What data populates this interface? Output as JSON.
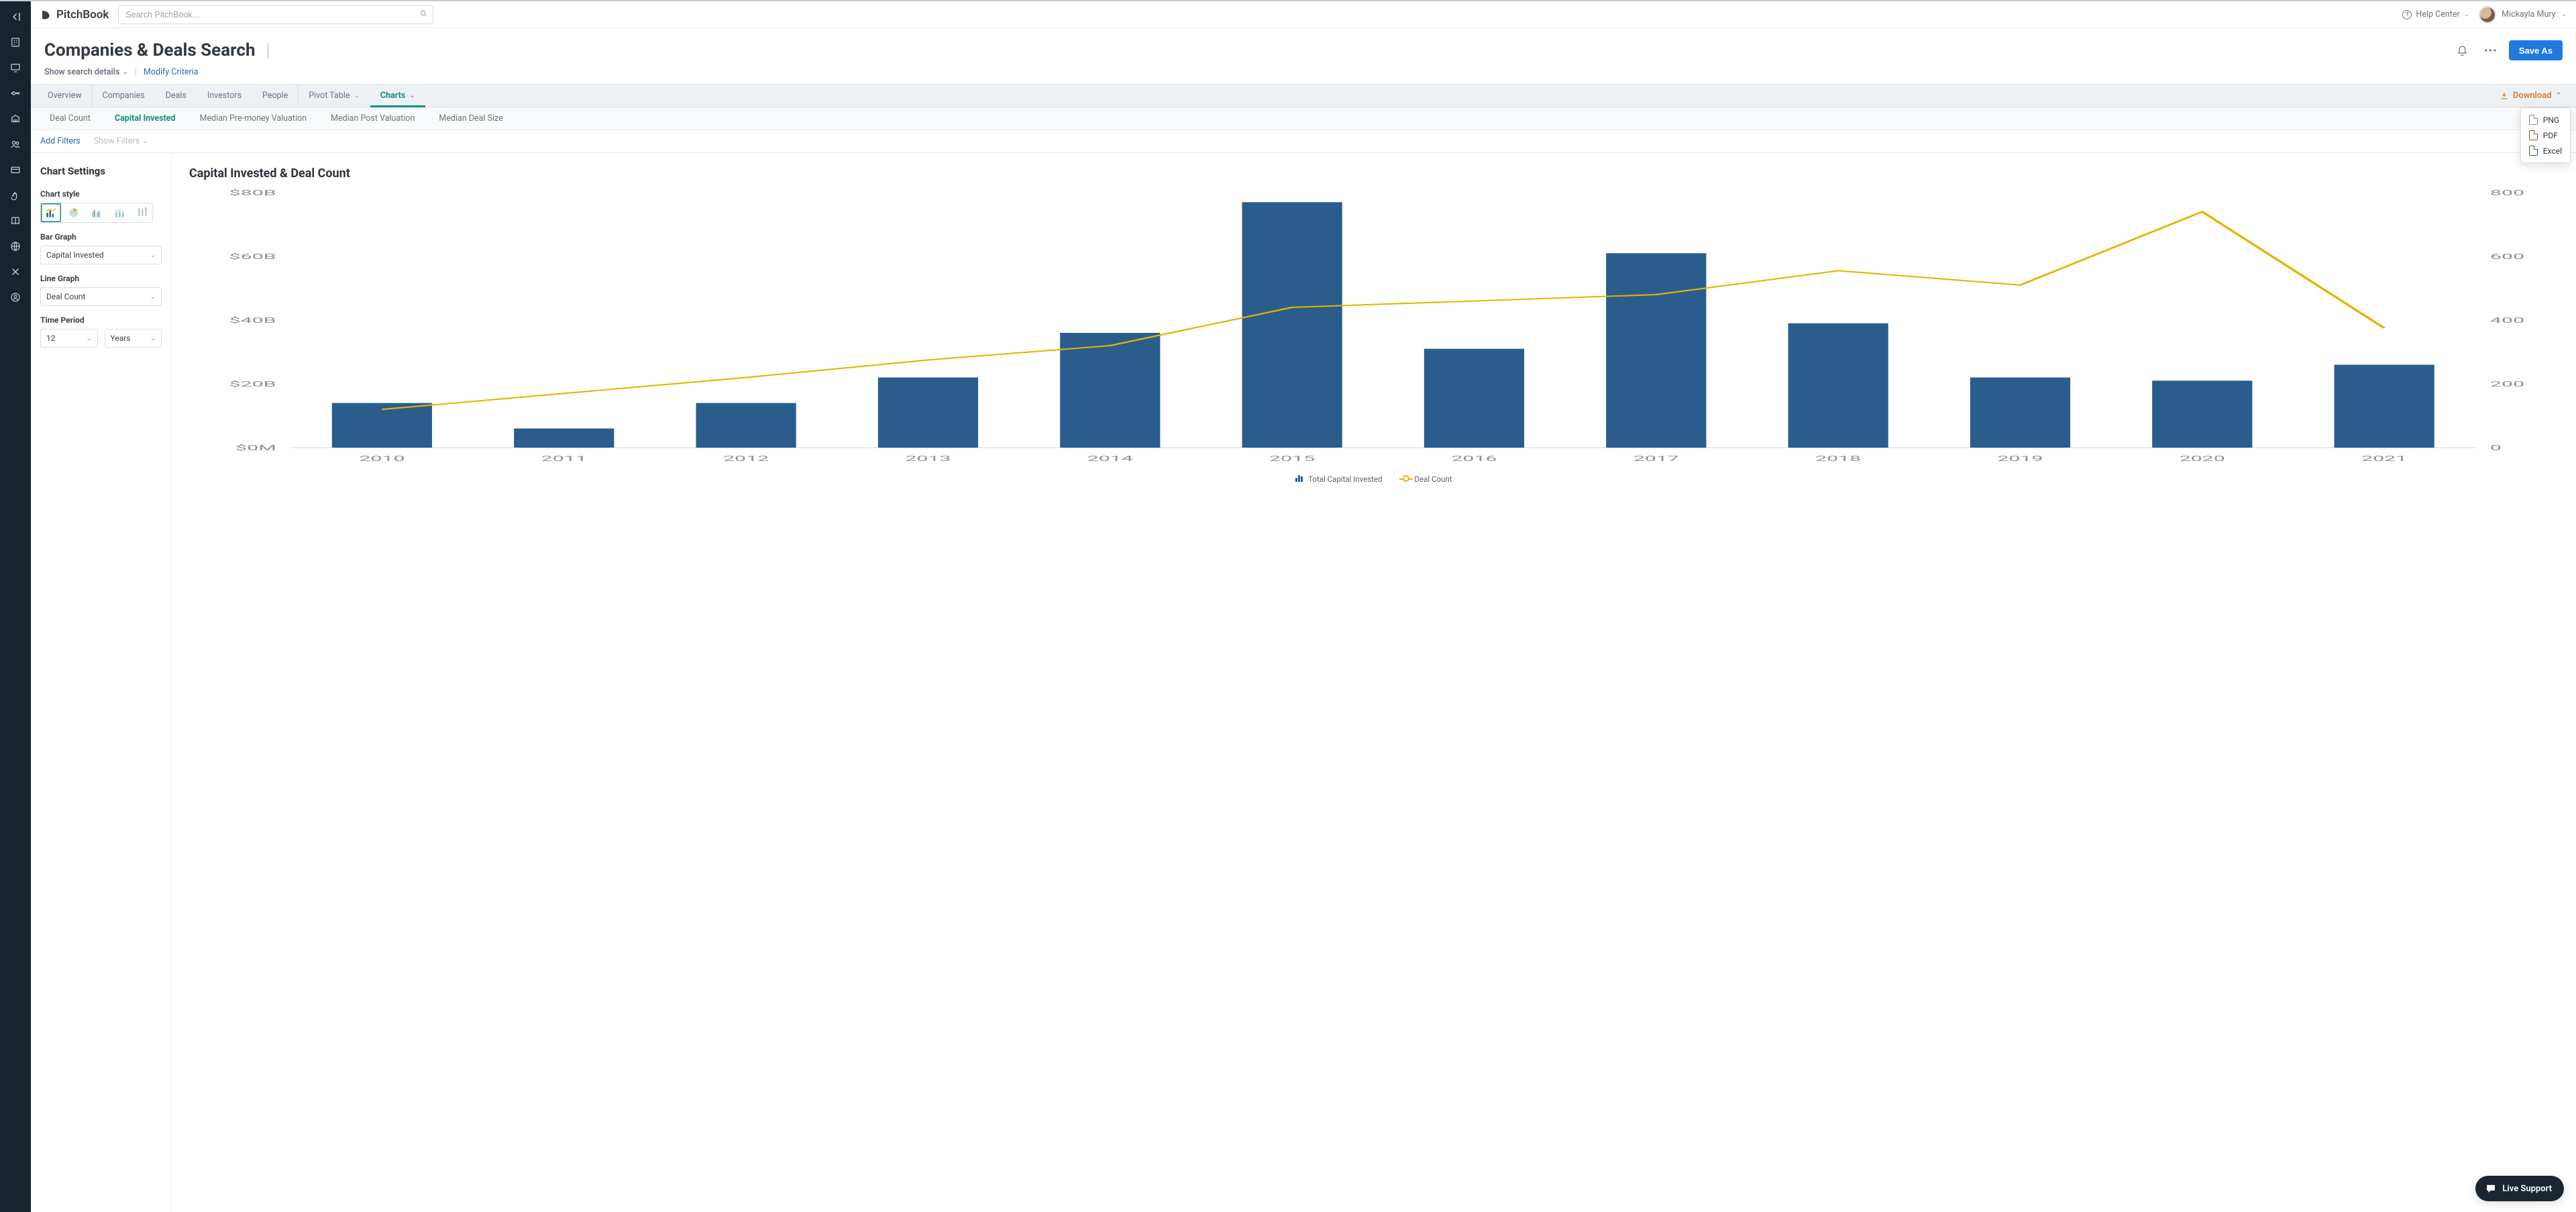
{
  "brand": "PitchBook",
  "search": {
    "placeholder": "Search PitchBook..."
  },
  "header": {
    "help": "Help Center",
    "user": "Mickayla Mury"
  },
  "page": {
    "title": "Companies & Deals Search",
    "show_details": "Show search details",
    "modify": "Modify Criteria",
    "save_as": "Save As"
  },
  "tabs": {
    "items": [
      "Overview",
      "Companies",
      "Deals",
      "Investors",
      "People",
      "Pivot Table",
      "Charts"
    ],
    "active": "Charts",
    "download": "Download",
    "download_options": [
      "PNG",
      "PDF",
      "Excel"
    ]
  },
  "subtabs": {
    "items": [
      "Deal Count",
      "Capital Invested",
      "Median Pre-money Valuation",
      "Median Post Valuation",
      "Median Deal Size"
    ],
    "active": "Capital Invested"
  },
  "filters": {
    "add": "Add Filters",
    "show": "Show Filters"
  },
  "settings": {
    "heading": "Chart Settings",
    "style_label": "Chart style",
    "bar_label": "Bar Graph",
    "bar_value": "Capital Invested",
    "line_label": "Line Graph",
    "line_value": "Deal Count",
    "period_label": "Time Period",
    "period_num": "12",
    "period_unit": "Years"
  },
  "chart": {
    "title": "Capital Invested & Deal Count",
    "legend_bar": "Total Capital Invested",
    "legend_line": "Deal Count"
  },
  "chart_data": {
    "type": "bar",
    "categories": [
      "2010",
      "2011",
      "2012",
      "2013",
      "2014",
      "2015",
      "2016",
      "2017",
      "2018",
      "2019",
      "2020",
      "2021"
    ],
    "series": [
      {
        "name": "Total Capital Invested",
        "kind": "bar",
        "axis": "left",
        "values": [
          14,
          6,
          14,
          22,
          36,
          77,
          31,
          61,
          39,
          22,
          21,
          26
        ]
      },
      {
        "name": "Deal Count",
        "kind": "line",
        "axis": "right",
        "values": [
          120,
          170,
          220,
          275,
          320,
          440,
          460,
          480,
          555,
          510,
          740,
          375
        ]
      }
    ],
    "y_left": {
      "label": "",
      "min": 0,
      "max": 80,
      "ticks": [
        "$0M",
        "$20B",
        "$40B",
        "$60B",
        "$80B"
      ]
    },
    "y_right": {
      "label": "",
      "min": 0,
      "max": 800,
      "ticks": [
        "0",
        "200",
        "400",
        "600",
        "800"
      ]
    }
  },
  "live_support": "Live Support"
}
